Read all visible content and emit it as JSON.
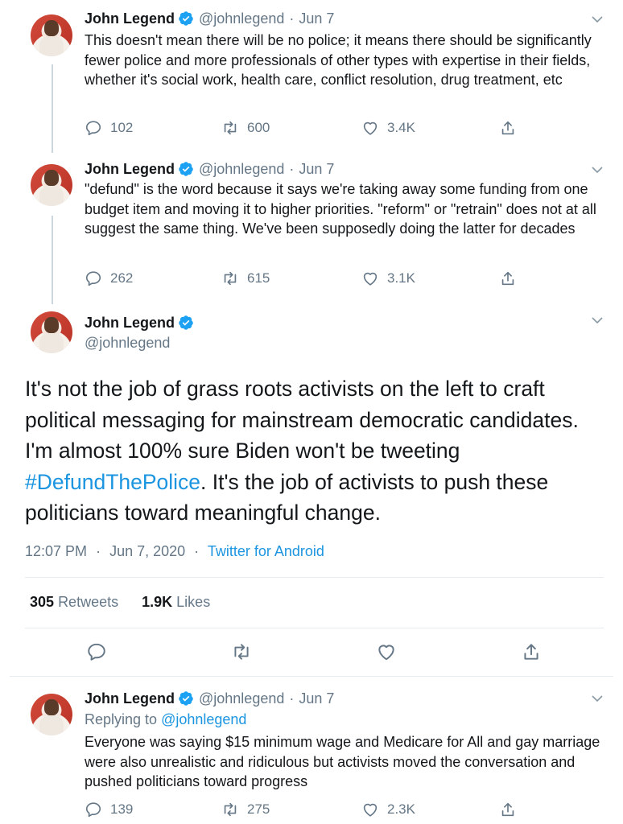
{
  "tweets": [
    {
      "name": "John Legend",
      "handle": "@johnlegend",
      "date": "Jun 7",
      "text": "This doesn't mean there will be no police; it means there should be significantly fewer police and more professionals of other types with expertise in their fields, whether it's social work, health care, conflict resolution, drug treatment, etc",
      "replies": "102",
      "retweets": "600",
      "likes": "3.4K"
    },
    {
      "name": "John Legend",
      "handle": "@johnlegend",
      "date": "Jun 7",
      "text": "\"defund\" is the word because it says we're taking away some funding from one budget item and moving it to higher priorities. \"reform\" or \"retrain\" does not at all suggest the same thing. We've been supposedly doing the latter for decades",
      "replies": "262",
      "retweets": "615",
      "likes": "3.1K"
    }
  ],
  "main_tweet": {
    "name": "John Legend",
    "handle": "@johnlegend",
    "text_before": "It's not the job of grass roots activists on the left to craft political messaging for mainstream democratic candidates. I'm almost 100% sure Biden won't be tweeting ",
    "hashtag": "#DefundThePolice",
    "text_after": ".  It's the job of activists to push these politicians toward meaningful change.",
    "time": "12:07 PM",
    "date": "Jun 7, 2020",
    "source": "Twitter for Android",
    "retweet_count": "305",
    "retweet_label": "Retweets",
    "like_count": "1.9K",
    "like_label": "Likes"
  },
  "reply_tweet": {
    "name": "John Legend",
    "handle": "@johnlegend",
    "date": "Jun 7",
    "replying_label": "Replying to",
    "replying_handle": "@johnlegend",
    "text": "Everyone was saying $15 minimum wage and Medicare for All and gay marriage were also unrealistic and ridiculous but activists moved the conversation and pushed politicians toward progress",
    "replies": "139",
    "retweets": "275",
    "likes": "2.3K"
  },
  "separator": "·",
  "colors": {
    "accent": "#1b95e0",
    "muted": "#657786",
    "text": "#14171a"
  }
}
